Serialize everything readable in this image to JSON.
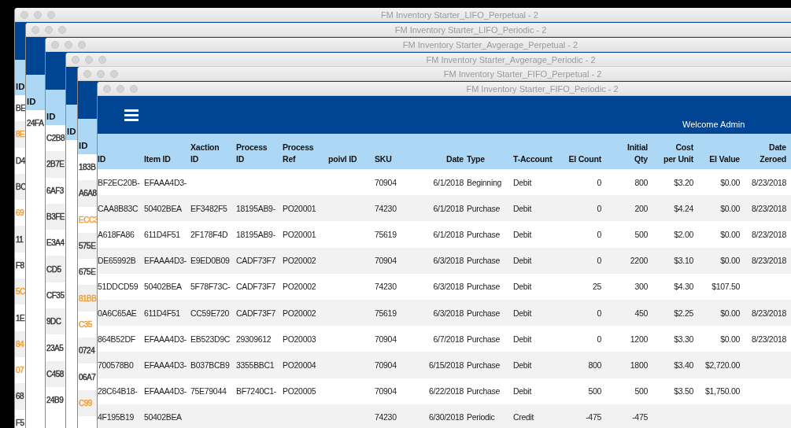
{
  "windows": [
    {
      "title": "FM Inventory Starter_LIFO_Perpetual - 2",
      "id_header": "ID",
      "rows": [
        {
          "id": "BE",
          "color": "#333333"
        },
        {
          "id": "8E",
          "color": "#f39a2e"
        },
        {
          "id": "D4",
          "color": "#333333"
        },
        {
          "id": "BC",
          "color": "#333333"
        },
        {
          "id": "69",
          "color": "#f39a2e"
        },
        {
          "id": "11",
          "color": "#333333"
        },
        {
          "id": "F8",
          "color": "#333333"
        },
        {
          "id": "5C",
          "color": "#f39a2e"
        },
        {
          "id": "1E",
          "color": "#333333"
        },
        {
          "id": "84",
          "color": "#f39a2e"
        },
        {
          "id": "07",
          "color": "#f39a2e"
        },
        {
          "id": "68",
          "color": "#333333"
        },
        {
          "id": "F5",
          "color": "#333333"
        }
      ]
    },
    {
      "title": "FM Inventory Starter_LIFO_Periodic - 2",
      "id_header": "ID",
      "rows": [
        {
          "id": "24FA",
          "color": "#333333"
        }
      ]
    },
    {
      "title": "FM Inventory Starter_Avgerage_Perpetual - 2",
      "id_header": "ID",
      "rows": [
        {
          "id": "C2B8",
          "color": "#333333"
        },
        {
          "id": "2B7E",
          "color": "#333333"
        },
        {
          "id": "6AF3",
          "color": "#333333"
        },
        {
          "id": "B3FE",
          "color": "#333333"
        },
        {
          "id": "E3A4",
          "color": "#333333"
        },
        {
          "id": "CD5",
          "color": "#333333"
        },
        {
          "id": "CF35",
          "color": "#333333"
        },
        {
          "id": "9DC",
          "color": "#333333"
        },
        {
          "id": "23A5",
          "color": "#333333"
        },
        {
          "id": "C458",
          "color": "#333333"
        },
        {
          "id": "24B9",
          "color": "#333333"
        }
      ]
    },
    {
      "title": "FM Inventory Starter_Avgerage_Periodic - 2",
      "id_header": "ID"
    },
    {
      "title": "FM Inventory Starter_FIFO_Perpetual - 2",
      "id_header": "ID",
      "rows": [
        {
          "id": "183B",
          "color": "#333333"
        },
        {
          "id": "A6A8",
          "color": "#333333"
        },
        {
          "id": "ECC3",
          "color": "#f39a2e"
        },
        {
          "id": "575E",
          "color": "#333333"
        },
        {
          "id": "675E",
          "color": "#333333"
        },
        {
          "id": "81BB",
          "color": "#f39a2e"
        },
        {
          "id": "C35",
          "color": "#f39a2e"
        },
        {
          "id": "0724",
          "color": "#333333"
        },
        {
          "id": "06A7",
          "color": "#333333"
        },
        {
          "id": "C99",
          "color": "#f39a2e"
        }
      ]
    }
  ],
  "main": {
    "title": "FM Inventory Starter_FIFO_Periodic - 2",
    "welcome": "Welcome Admin",
    "table": {
      "columns": [
        {
          "label": "ID"
        },
        {
          "label": "Item ID"
        },
        {
          "label": "Xaction\nID"
        },
        {
          "label": "Process\nID"
        },
        {
          "label": "Process\nRef"
        },
        {
          "label": "poivl ID"
        },
        {
          "label": "SKU"
        },
        {
          "label": "Date"
        },
        {
          "label": "Type"
        },
        {
          "label": "T-Account"
        },
        {
          "label": "EI Count"
        },
        {
          "label": "Initial\nQty"
        },
        {
          "label": "Cost\nper Unit"
        },
        {
          "label": "EI Value"
        },
        {
          "label": "Date\nZeroed"
        }
      ],
      "rows": [
        [
          "BF2EC20B-",
          "EFAAA4D3-",
          "",
          "",
          "",
          "",
          "70904",
          "6/1/2018",
          "Beginning",
          "Debit",
          "0",
          "800",
          "$3.20",
          "$0.00",
          "8/23/2018"
        ],
        [
          "CAA8B83C",
          "50402BEA",
          "EF3482F5",
          "18195AB9-",
          "PO20001",
          "",
          "74230",
          "6/1/2018",
          "Purchase",
          "Debit",
          "0",
          "200",
          "$4.24",
          "$0.00",
          "8/23/2018"
        ],
        [
          "A618FA86",
          "611D4F51",
          "2F178F4D",
          "18195AB9-",
          "PO20001",
          "",
          "75619",
          "6/1/2018",
          "Purchase",
          "Debit",
          "0",
          "500",
          "$2.00",
          "$0.00",
          "8/23/2018"
        ],
        [
          "DE65992B",
          "EFAAA4D3-",
          "E9ED0B09",
          "CADF73F7",
          "PO20002",
          "",
          "70904",
          "6/3/2018",
          "Purchase",
          "Debit",
          "0",
          "2200",
          "$3.10",
          "$0.00",
          "8/23/2018"
        ],
        [
          "51DDCD59",
          "50402BEA",
          "5F78F73C-",
          "CADF73F7",
          "PO20002",
          "",
          "74230",
          "6/3/2018",
          "Purchase",
          "Debit",
          "25",
          "300",
          "$4.30",
          "$107.50",
          ""
        ],
        [
          "0A6C65AE",
          "611D4F51",
          "CC59E720",
          "CADF73F7",
          "PO20002",
          "",
          "75619",
          "6/3/2018",
          "Purchase",
          "Debit",
          "0",
          "450",
          "$2.25",
          "$0.00",
          "8/23/2018"
        ],
        [
          "864B52DF",
          "EFAAA4D3-",
          "EB523D9C",
          "29309612",
          "PO20003",
          "",
          "70904",
          "6/7/2018",
          "Purchase",
          "Debit",
          "0",
          "1200",
          "$3.30",
          "$0.00",
          "8/23/2018"
        ],
        [
          "700578B0",
          "EFAAA4D3-",
          "B037BCB9",
          "3355BBC1",
          "PO20004",
          "",
          "70904",
          "6/15/2018",
          "Purchase",
          "Debit",
          "800",
          "1800",
          "$3.40",
          "$2,720.00",
          ""
        ],
        [
          "28C64B18-",
          "EFAAA4D3-",
          "75E79044",
          "BF7240C1-",
          "PO20005",
          "",
          "70904",
          "6/22/2018",
          "Purchase",
          "Debit",
          "500",
          "500",
          "$3.50",
          "$1,750.00",
          ""
        ],
        [
          "4F195B19",
          "50402BEA",
          "",
          "",
          "",
          "",
          "74230",
          "6/30/2018",
          "Periodic",
          "Credit",
          "-475",
          "-475",
          "",
          "",
          ""
        ]
      ]
    }
  }
}
